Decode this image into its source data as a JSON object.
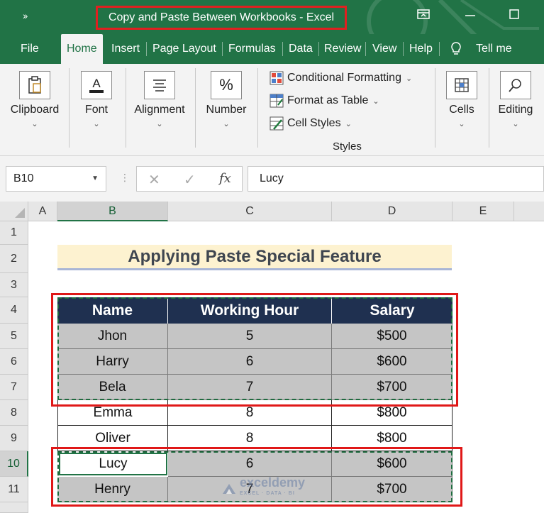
{
  "window": {
    "qat_icon": "chevron-double-right-icon",
    "title": "Copy and Paste Between Workbooks  -  Excel",
    "accent_color": "#217346"
  },
  "tabs": [
    "File",
    "Home",
    "Insert",
    "Page Layout",
    "Formulas",
    "Data",
    "Review",
    "View",
    "Help",
    "Tell me"
  ],
  "active_tab": "Home",
  "ribbon": {
    "clipboard": "Clipboard",
    "font": "Font",
    "alignment": "Alignment",
    "number": "Number",
    "number_symbol": "%",
    "conditional_formatting": "Conditional Formatting",
    "format_as_table": "Format as Table",
    "cell_styles": "Cell Styles",
    "styles_group": "Styles",
    "cells": "Cells",
    "editing": "Editing"
  },
  "formula_bar": {
    "name_box": "B10",
    "fx": "fx",
    "value": "Lucy"
  },
  "columns": [
    "A",
    "B",
    "C",
    "D",
    "E"
  ],
  "rows": [
    "1",
    "2",
    "3",
    "4",
    "5",
    "6",
    "7",
    "8",
    "9",
    "10",
    "11"
  ],
  "sheet": {
    "title": "Applying Paste Special Feature",
    "headers": [
      "Name",
      "Working Hour",
      "Salary"
    ],
    "data": [
      [
        "Jhon",
        "5",
        "$500"
      ],
      [
        "Harry",
        "6",
        "$600"
      ],
      [
        "Bela",
        "7",
        "$700"
      ],
      [
        "Emma",
        "8",
        "$800"
      ],
      [
        "Oliver",
        "8",
        "$800"
      ],
      [
        "Lucy",
        "6",
        "$600"
      ],
      [
        "Henry",
        "7",
        "$700"
      ]
    ]
  },
  "watermark": {
    "name": "exceldemy",
    "tagline": "EXCEL · DATA · BI"
  },
  "colors": {
    "header_fill": "#1f3050",
    "title_fill": "#fdf2d0",
    "copied_fill": "#c5c5c5",
    "highlight_border": "#e01818"
  }
}
